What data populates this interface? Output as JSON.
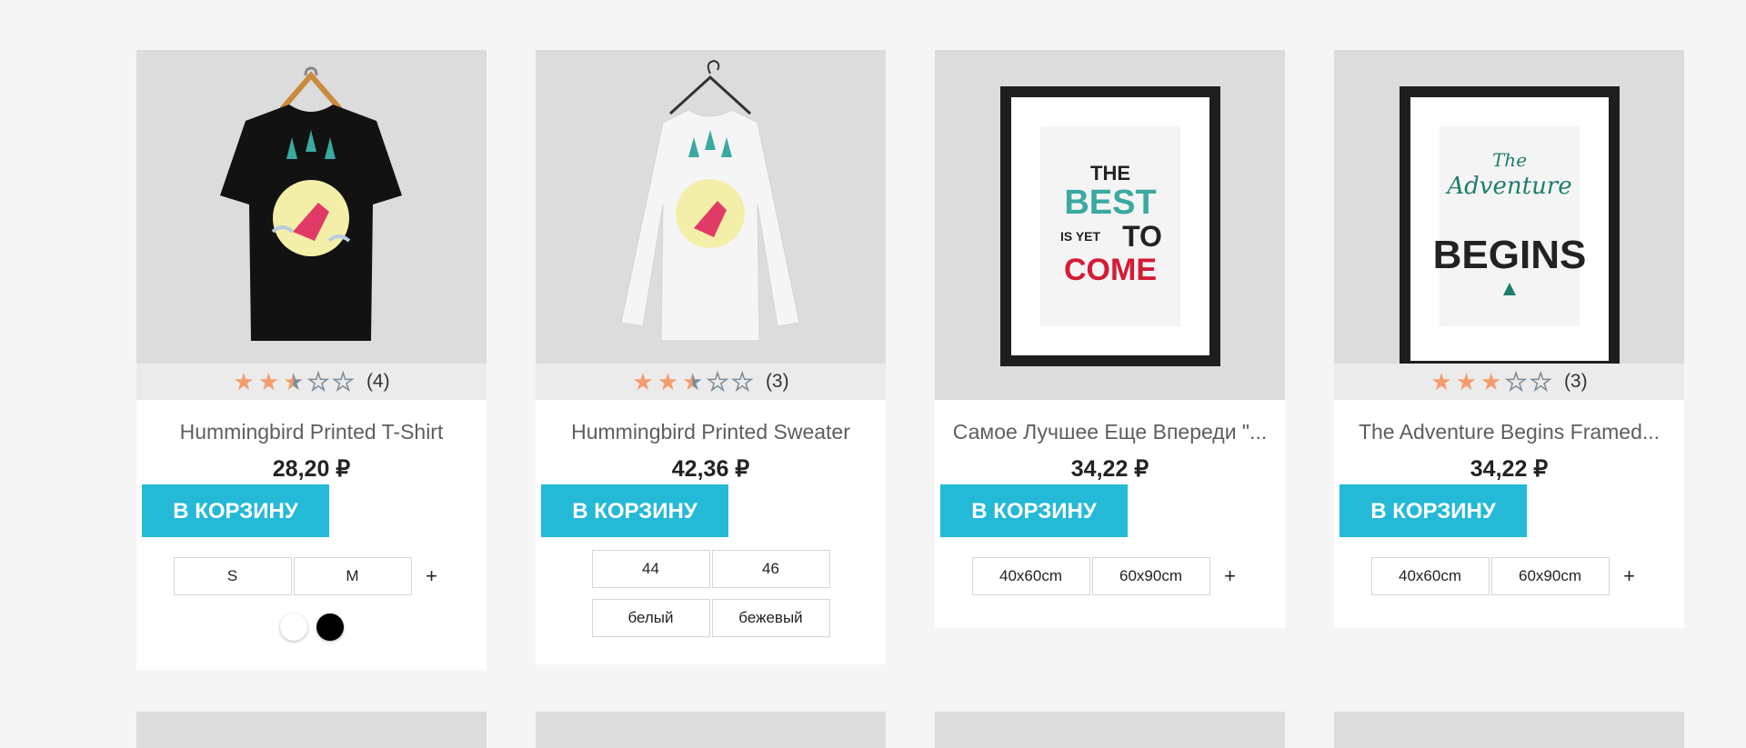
{
  "products": [
    {
      "title": "Hummingbird Printed T-Shirt",
      "price": "28,20 ₽",
      "rating": 2.5,
      "rating_count": "(4)",
      "cart_label": "В КОРЗИНУ",
      "variants": [
        "S",
        "M"
      ],
      "more": "+",
      "colors": [
        "#ffffff",
        "#000000"
      ]
    },
    {
      "title": "Hummingbird Printed Sweater",
      "price": "42,36 ₽",
      "rating": 2.5,
      "rating_count": "(3)",
      "cart_label": "В КОРЗИНУ",
      "variants": [
        "44",
        "46"
      ],
      "variants2": [
        "белый",
        "бежевый"
      ]
    },
    {
      "title": "Самое Лучшее Еще Впереди \"...",
      "price": "34,22 ₽",
      "cart_label": "В КОРЗИНУ",
      "variants": [
        "40x60cm",
        "60x90cm"
      ],
      "more": "+",
      "poster_text": [
        "THE",
        "BEST",
        "IS YET",
        "TO",
        "COME"
      ]
    },
    {
      "title": "The Adventure Begins Framed...",
      "price": "34,22 ₽",
      "rating": 3,
      "rating_count": "(3)",
      "cart_label": "В КОРЗИНУ",
      "variants": [
        "40x60cm",
        "60x90cm"
      ],
      "more": "+",
      "poster_text": [
        "The",
        "Adventure",
        "BEGINS"
      ]
    }
  ],
  "colors": {
    "accent": "#24b9d7",
    "star": "#f59b6d",
    "page_bg": "#f5f5f5",
    "thumb_bg": "#dcdcdc"
  }
}
